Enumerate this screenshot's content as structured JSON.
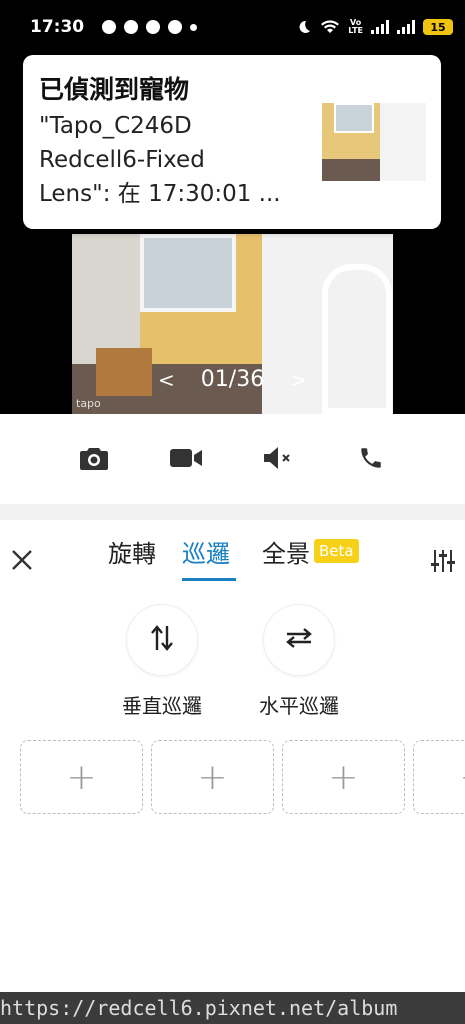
{
  "status_bar": {
    "time": "17:30",
    "volte": "Vo\nLTE",
    "battery": "15"
  },
  "notification": {
    "title": "已偵測到寵物",
    "body": "\"Tapo_C246D\nRedcell6-Fixed\nLens\": 在 17:30:01 ..."
  },
  "video": {
    "pager_prev": "<",
    "pager_text": "01/36",
    "pager_next": ">",
    "logo": "tapo"
  },
  "sheet": {
    "tabs": [
      {
        "label": "旋轉"
      },
      {
        "label": "巡邏"
      },
      {
        "label": "全景"
      }
    ],
    "beta_badge": "Beta",
    "vertical_patrol": "垂直巡邏",
    "horizontal_patrol": "水平巡邏",
    "slot_plus": "+"
  },
  "watermark": "https://redcell6.pixnet.net/album",
  "colors": {
    "accent": "#1a7fc3",
    "beta": "#f7d117",
    "battery": "#f1c40f"
  }
}
